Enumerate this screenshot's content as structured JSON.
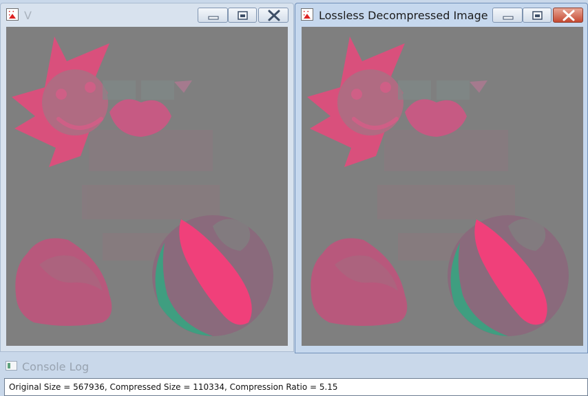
{
  "windows": {
    "v": {
      "title": "V",
      "controls": {
        "minimize": "minimize",
        "maximize": "maximize",
        "close": "close"
      }
    },
    "lossless": {
      "title": "Lossless Decompressed Image",
      "controls": {
        "minimize": "minimize",
        "maximize": "maximize",
        "close": "close"
      }
    }
  },
  "console": {
    "title": "Console Log",
    "log": "Original Size = 567936, Compressed Size = 110334, Compression Ratio = 5.15"
  },
  "icons": {
    "app": "image-app-icon",
    "console": "console-icon",
    "minimize": "minimize-icon",
    "maximize": "maximize-icon",
    "close": "close-icon"
  },
  "colors": {
    "image_background": "#7f7f7f",
    "pink": "#e0527f",
    "green": "#3f9e80",
    "close_button_active": "#c64a33"
  }
}
